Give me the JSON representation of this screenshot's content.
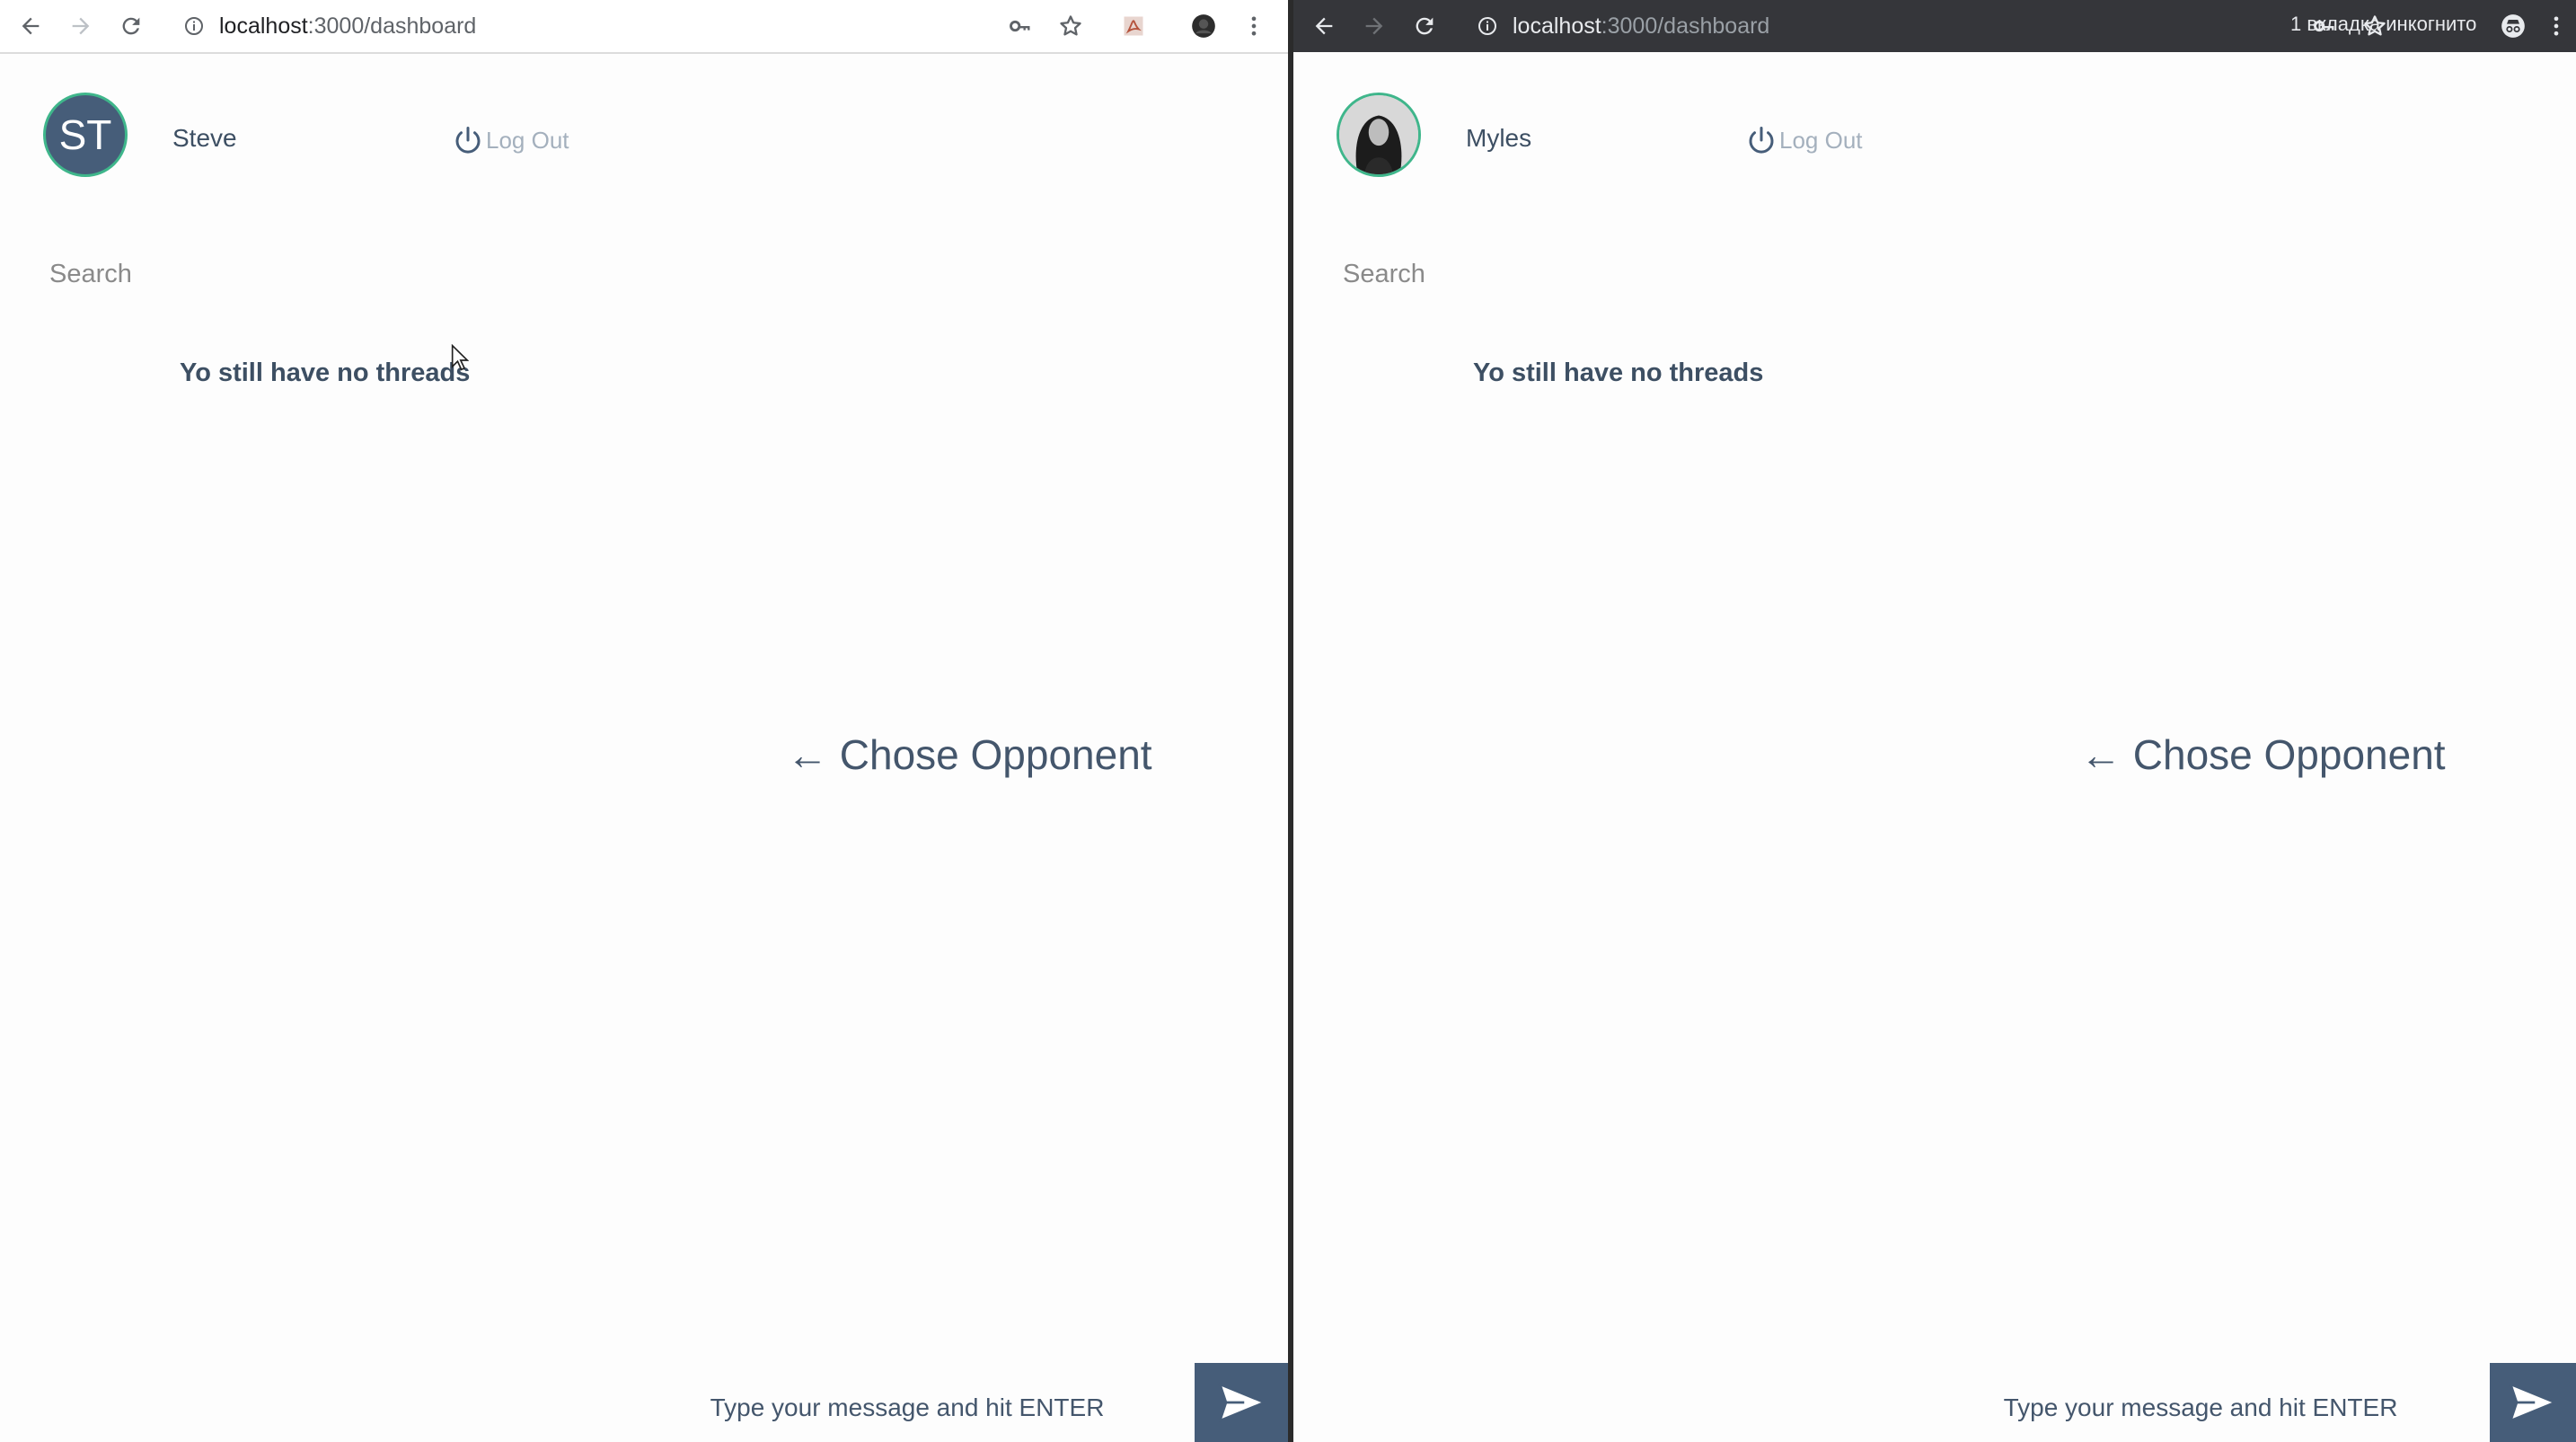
{
  "left_window": {
    "browser": {
      "url_host": "localhost",
      "url_path": ":3000/dashboard"
    },
    "user": {
      "initials": "ST",
      "name": "Steve"
    },
    "logout_label": "Log Out",
    "search_placeholder": "Search",
    "empty_message": "Yo still have no threads",
    "chose_opponent": "← Chose Opponent",
    "message_placeholder": "Type your message and hit ENTER"
  },
  "right_window": {
    "browser": {
      "url_host": "localhost",
      "url_path": ":3000/dashboard",
      "incognito_label": "1 вкладка инкогнито"
    },
    "user": {
      "name": "Myles"
    },
    "logout_label": "Log Out",
    "search_placeholder": "Search",
    "empty_message": "Yo still have no threads",
    "chose_opponent": "← Chose Opponent",
    "message_placeholder": "Type your message and hit ENTER"
  },
  "colors": {
    "accent_dark": "#465d79",
    "avatar_ring": "#3fb68b",
    "text": "#3d4f63",
    "muted": "#a4b0bd",
    "incognito_chrome": "#35363a"
  },
  "icons": [
    "back-arrow-icon",
    "forward-arrow-icon",
    "reload-icon",
    "info-icon",
    "key-icon",
    "star-icon",
    "pdf-extension-icon",
    "profile-icon",
    "menu-dots-icon",
    "incognito-icon",
    "power-icon",
    "send-icon"
  ]
}
